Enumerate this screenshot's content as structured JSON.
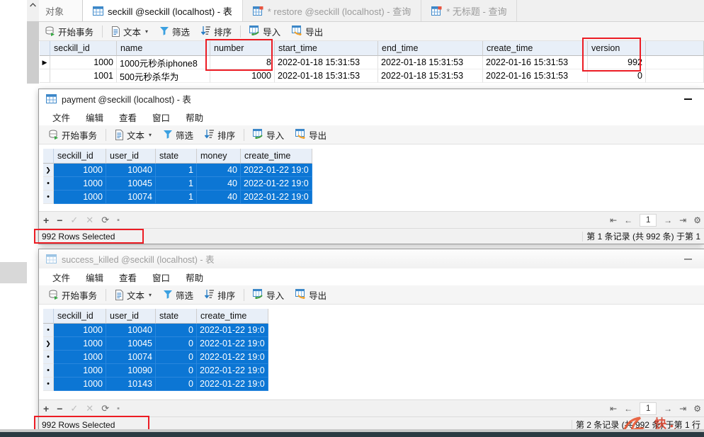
{
  "app": {
    "tabs": [
      {
        "label": "对象",
        "icon": "none",
        "state": "object"
      },
      {
        "label": "seckill @seckill (localhost) - 表",
        "icon": "table-icon",
        "state": "active"
      },
      {
        "label": "* restore @seckill (localhost) - 查询",
        "icon": "query-icon",
        "state": "inactive"
      },
      {
        "label": "* 无标题 - 查询",
        "icon": "query-icon",
        "state": "inactive"
      }
    ],
    "toolbar": [
      {
        "label": "开始事务",
        "icon": "transaction-icon"
      },
      {
        "label": "文本",
        "icon": "text-icon",
        "caret": "▾"
      },
      {
        "label": "筛选",
        "icon": "filter-icon"
      },
      {
        "label": "排序",
        "icon": "sort-icon"
      },
      {
        "label": "导入",
        "icon": "import-icon"
      },
      {
        "label": "导出",
        "icon": "export-icon"
      }
    ],
    "grid": {
      "columns": [
        "seckill_id",
        "name",
        "number",
        "start_time",
        "end_time",
        "create_time",
        "version"
      ],
      "rows": [
        {
          "marker": "▶",
          "selected": false,
          "cells": [
            "1000",
            "1000元秒杀iphone8",
            "8",
            "2022-01-18 15:31:53",
            "2022-01-18 15:31:53",
            "2022-01-16 15:31:53",
            "992"
          ]
        },
        {
          "marker": "",
          "selected": false,
          "cells": [
            "1001",
            "500元秒杀华为",
            "1000",
            "2022-01-18 15:31:53",
            "2022-01-18 15:31:53",
            "2022-01-16 15:31:53",
            "0"
          ]
        }
      ]
    }
  },
  "payment_window": {
    "title": "payment @seckill (localhost) - 表",
    "title_icon": "table-icon",
    "minimize_label": "—",
    "menus": [
      "文件",
      "编辑",
      "查看",
      "窗口",
      "帮助"
    ],
    "toolbar": [
      {
        "label": "开始事务",
        "icon": "transaction-icon"
      },
      {
        "label": "文本",
        "icon": "text-icon",
        "caret": "▾"
      },
      {
        "label": "筛选",
        "icon": "filter-icon"
      },
      {
        "label": "排序",
        "icon": "sort-icon"
      },
      {
        "label": "导入",
        "icon": "import-icon"
      },
      {
        "label": "导出",
        "icon": "export-icon"
      }
    ],
    "grid": {
      "columns": [
        "seckill_id",
        "user_id",
        "state",
        "money",
        "create_time"
      ],
      "rows": [
        {
          "marker": "❯",
          "selected": true,
          "cells": [
            "1000",
            "10040",
            "1",
            "40",
            "2022-01-22 19:0"
          ]
        },
        {
          "marker": "•",
          "selected": true,
          "cells": [
            "1000",
            "10045",
            "1",
            "40",
            "2022-01-22 19:0"
          ]
        },
        {
          "marker": "•",
          "selected": true,
          "cells": [
            "1000",
            "10074",
            "1",
            "40",
            "2022-01-22 19:0"
          ]
        }
      ]
    },
    "footer": {
      "buttons": [
        "+",
        "−",
        "✓",
        "✕",
        "⟳",
        "▪"
      ],
      "nav": {
        "first": "⇤",
        "prev": "←",
        "page": "1",
        "next": "→",
        "last": "⇥",
        "settings": "⚙"
      }
    },
    "status": {
      "left": "992 Rows Selected",
      "right": "第 1 条记录 (共 992 条) 于第 1"
    }
  },
  "success_window": {
    "title": "success_killed @seckill (localhost) - 表",
    "title_icon": "table-icon",
    "minimize_label": "—",
    "menus": [
      "文件",
      "编辑",
      "查看",
      "窗口",
      "帮助"
    ],
    "toolbar": [
      {
        "label": "开始事务",
        "icon": "transaction-icon"
      },
      {
        "label": "文本",
        "icon": "text-icon",
        "caret": "▾"
      },
      {
        "label": "筛选",
        "icon": "filter-icon"
      },
      {
        "label": "排序",
        "icon": "sort-icon"
      },
      {
        "label": "导入",
        "icon": "import-icon"
      },
      {
        "label": "导出",
        "icon": "export-icon"
      }
    ],
    "grid": {
      "columns": [
        "seckill_id",
        "user_id",
        "state",
        "create_time"
      ],
      "rows": [
        {
          "marker": "•",
          "selected": true,
          "cells": [
            "1000",
            "10040",
            "0",
            "2022-01-22 19:0"
          ]
        },
        {
          "marker": "❯",
          "selected": true,
          "cells": [
            "1000",
            "10045",
            "0",
            "2022-01-22 19:0"
          ]
        },
        {
          "marker": "•",
          "selected": true,
          "cells": [
            "1000",
            "10074",
            "0",
            "2022-01-22 19:0"
          ]
        },
        {
          "marker": "•",
          "selected": true,
          "cells": [
            "1000",
            "10090",
            "0",
            "2022-01-22 19:0"
          ]
        },
        {
          "marker": "•",
          "selected": true,
          "cells": [
            "1000",
            "10143",
            "0",
            "2022-01-22 19:0"
          ]
        }
      ]
    },
    "footer": {
      "buttons": [
        "+",
        "−",
        "✓",
        "✕",
        "⟳",
        "▪"
      ],
      "nav": {
        "first": "⇤",
        "prev": "←",
        "page": "1",
        "next": "→",
        "last": "⇥",
        "settings": "⚙"
      }
    },
    "status": {
      "left": "992 Rows Selected",
      "right": "第 2 条记录 (共 992 条) 于第 1 行"
    }
  },
  "annotations": {
    "highlight_color": "#ec1c24",
    "boxes": [
      {
        "name": "number-column-highlight"
      },
      {
        "name": "version-column-highlight"
      },
      {
        "name": "payment-rows-selected-highlight"
      },
      {
        "name": "success-rows-selected-highlight"
      }
    ]
  },
  "watermark": {
    "text": "优快"
  }
}
